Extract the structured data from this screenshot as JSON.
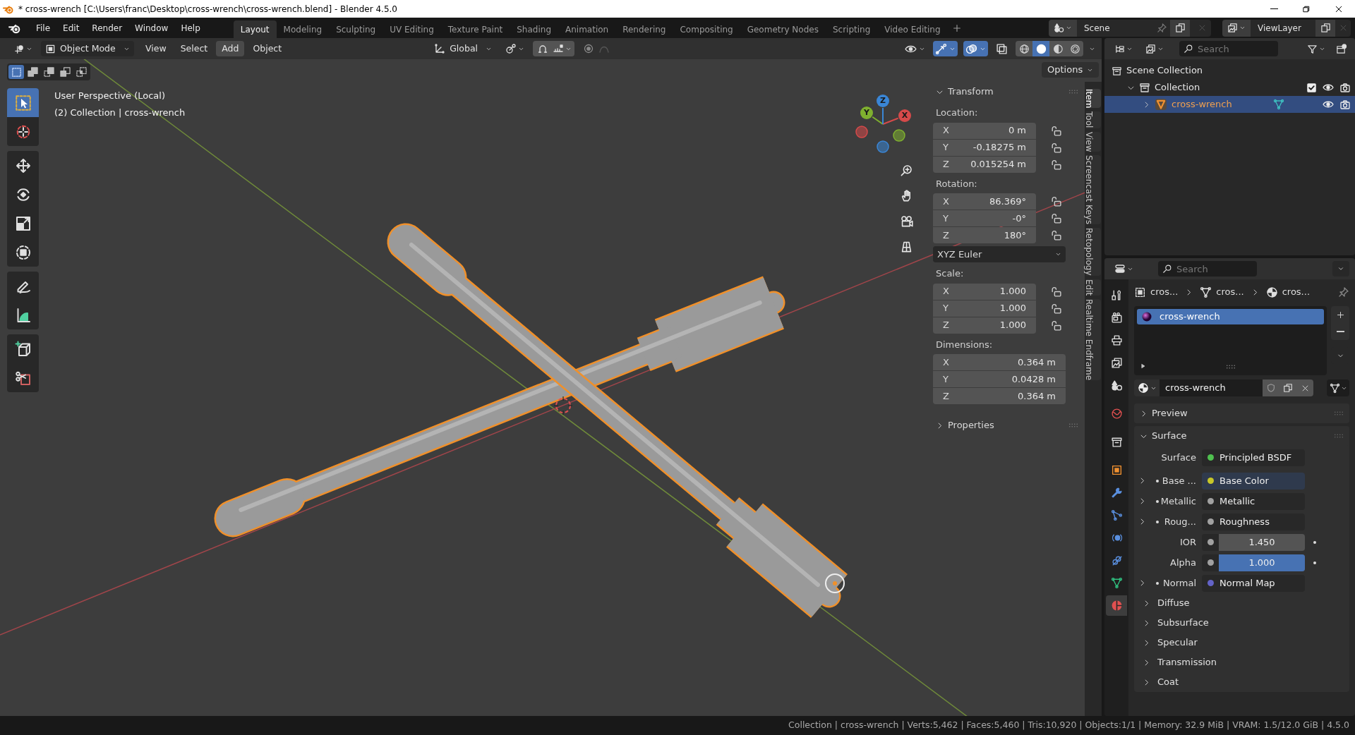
{
  "window": {
    "title": "* cross-wrench [C:\\Users\\franc\\Desktop\\cross-wrench\\cross-wrench.blend] - Blender 4.5.0"
  },
  "menu": [
    "File",
    "Edit",
    "Render",
    "Window",
    "Help"
  ],
  "workspaces": [
    {
      "label": "Layout",
      "selected": true
    },
    {
      "label": "Modeling",
      "selected": false
    },
    {
      "label": "Sculpting",
      "selected": false
    },
    {
      "label": "UV Editing",
      "selected": false
    },
    {
      "label": "Texture Paint",
      "selected": false
    },
    {
      "label": "Shading",
      "selected": false
    },
    {
      "label": "Animation",
      "selected": false
    },
    {
      "label": "Rendering",
      "selected": false
    },
    {
      "label": "Compositing",
      "selected": false
    },
    {
      "label": "Geometry Nodes",
      "selected": false
    },
    {
      "label": "Scripting",
      "selected": false
    },
    {
      "label": "Video Editing",
      "selected": false
    }
  ],
  "scene": "Scene",
  "view_layer": "ViewLayer",
  "viewport_header": {
    "mode": "Object Mode",
    "menus": [
      {
        "label": "View",
        "selected": false
      },
      {
        "label": "Select",
        "selected": false
      },
      {
        "label": "Add",
        "selected": true
      },
      {
        "label": "Object",
        "selected": false
      }
    ],
    "orientation": "Global",
    "left_toggles": [
      {
        "kind": "snap",
        "on": true
      },
      {
        "kind": "proportional",
        "on": false
      }
    ],
    "right_toggles": [
      {
        "kind": "visibility",
        "on": false
      },
      {
        "kind": "gizmo",
        "on": true
      },
      {
        "kind": "overlay",
        "on": true
      },
      {
        "kind": "xray",
        "on": false
      }
    ],
    "shading": [
      {
        "kind": "wireframe",
        "selected": false
      },
      {
        "kind": "solid",
        "selected": true
      },
      {
        "kind": "material",
        "selected": false
      },
      {
        "kind": "rendered",
        "selected": false
      }
    ],
    "options": "Options"
  },
  "select_modes": [
    {
      "kind": "set",
      "selected": true
    },
    {
      "kind": "extend",
      "selected": false
    },
    {
      "kind": "subtract",
      "selected": false
    },
    {
      "kind": "invert",
      "selected": false
    },
    {
      "kind": "intersect",
      "selected": false
    }
  ],
  "tool_groups": [
    [
      {
        "kind": "select",
        "selected": true
      },
      {
        "kind": "cursor",
        "selected": false
      }
    ],
    [
      {
        "kind": "move",
        "selected": false
      },
      {
        "kind": "rotate",
        "selected": false
      },
      {
        "kind": "scale",
        "selected": false
      },
      {
        "kind": "transform",
        "selected": false
      }
    ],
    [
      {
        "kind": "annotate",
        "selected": false
      },
      {
        "kind": "measure",
        "selected": false
      }
    ],
    [
      {
        "kind": "add-cube",
        "selected": false
      },
      {
        "kind": "cut",
        "selected": false
      }
    ]
  ],
  "overlay_text": [
    "User Perspective (Local)",
    "(2) Collection | cross-wrench"
  ],
  "gizmo": {
    "axes": [
      {
        "label": "X",
        "color": "#d64a4a"
      },
      {
        "label": "Y",
        "color": "#7fb02f"
      },
      {
        "label": "Z",
        "color": "#3a86d6"
      }
    ]
  },
  "n_panel": {
    "tabs": [
      {
        "label": "Item",
        "selected": true
      },
      {
        "label": "Tool",
        "selected": false
      },
      {
        "label": "View",
        "selected": false
      },
      {
        "label": "Screencast Keys",
        "selected": false
      },
      {
        "label": "Retopology",
        "selected": false
      },
      {
        "label": "Edit",
        "selected": false
      },
      {
        "label": "Realtime Endframe",
        "selected": false
      }
    ],
    "transform": {
      "title": "Transform",
      "expanded": true,
      "groups": [
        {
          "label": "Location:",
          "fields": [
            {
              "axis": "X",
              "value": "0 m",
              "locked": false
            },
            {
              "axis": "Y",
              "value": "-0.18275 m",
              "locked": false
            },
            {
              "axis": "Z",
              "value": "0.015254 m",
              "locked": false
            }
          ]
        },
        {
          "label": "Rotation:",
          "fields": [
            {
              "axis": "X",
              "value": "86.369°",
              "locked": false
            },
            {
              "axis": "Y",
              "value": "-0°",
              "locked": false
            },
            {
              "axis": "Z",
              "value": "180°",
              "locked": false
            }
          ],
          "mode": "XYZ Euler"
        },
        {
          "label": "Scale:",
          "fields": [
            {
              "axis": "X",
              "value": "1.000",
              "locked": false
            },
            {
              "axis": "Y",
              "value": "1.000",
              "locked": false
            },
            {
              "axis": "Z",
              "value": "1.000",
              "locked": false
            }
          ]
        },
        {
          "label": "Dimensions:",
          "fields": [
            {
              "axis": "X",
              "value": "0.364 m"
            },
            {
              "axis": "Y",
              "value": "0.0428 m"
            },
            {
              "axis": "Z",
              "value": "0.364 m"
            }
          ]
        }
      ]
    },
    "properties": {
      "title": "Properties",
      "expanded": false
    }
  },
  "outliner": {
    "search": {
      "placeholder": "Search"
    },
    "tree": [
      {
        "label": "Scene Collection",
        "selected": false,
        "children": [
          {
            "label": "Collection",
            "expanded": true,
            "checked": true,
            "selected": false,
            "children": [
              {
                "label": "cross-wrench",
                "expanded": false,
                "selected": true
              }
            ]
          }
        ]
      }
    ]
  },
  "properties": {
    "search": {
      "placeholder": "Search"
    },
    "tabs": [
      {
        "kind": "tool",
        "selected": false
      },
      {
        "kind": "render",
        "selected": false
      },
      {
        "kind": "output",
        "selected": false
      },
      {
        "kind": "view-layer",
        "selected": false
      },
      {
        "kind": "scene",
        "selected": false
      },
      {
        "kind": "world",
        "selected": false
      },
      {
        "kind": "collection",
        "selected": false
      },
      {
        "kind": "object",
        "selected": false
      },
      {
        "kind": "modifiers",
        "selected": false
      },
      {
        "kind": "particles",
        "selected": false
      },
      {
        "kind": "physics",
        "selected": false
      },
      {
        "kind": "constraints",
        "selected": false
      },
      {
        "kind": "data",
        "selected": false
      },
      {
        "kind": "material",
        "selected": true
      }
    ],
    "breadcrumb": [
      "cros...",
      "cros...",
      "cros..."
    ],
    "slots": [
      {
        "name": "cross-wrench",
        "selected": true
      }
    ],
    "material": "cross-wrench",
    "panels": [
      {
        "title": "Preview",
        "expanded": false
      },
      {
        "title": "Surface",
        "expanded": true
      }
    ],
    "surface": {
      "label": "Surface",
      "shader": "Principled BSDF",
      "color": "#4fc04f"
    },
    "inputs": [
      {
        "kind": "link",
        "label": "Base ...",
        "value": "Base Color",
        "color": "#c7c729"
      },
      {
        "kind": "link",
        "label": "Metallic",
        "value": "Metallic",
        "color": "#a1a1a1"
      },
      {
        "kind": "link",
        "label": "Roug...",
        "value": "Roughness",
        "color": "#a1a1a1"
      },
      {
        "kind": "number",
        "label": "IOR",
        "value": "1.450"
      },
      {
        "kind": "number",
        "label": "Alpha",
        "value": "1.000",
        "level": 1
      },
      {
        "kind": "link",
        "label": "Normal",
        "value": "Normal Map",
        "color": "#6363c7"
      }
    ],
    "subpanels": [
      {
        "title": "Diffuse",
        "expanded": false
      },
      {
        "title": "Subsurface",
        "expanded": false
      },
      {
        "title": "Specular",
        "expanded": false
      },
      {
        "title": "Transmission",
        "expanded": false
      },
      {
        "title": "Coat",
        "expanded": false
      }
    ]
  },
  "status_bar": "Collection | cross-wrench | Verts:5,462 | Faces:5,460 | Tris:10,920 | Objects:1/1 | Memory: 32.9 MiB | VRAM: 1.5/12.0 GiB | 4.5.0"
}
